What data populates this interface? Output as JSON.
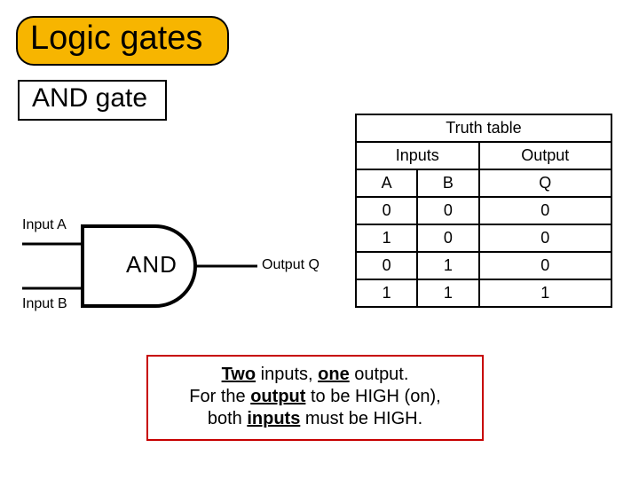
{
  "title": "Logic gates",
  "subtitle": "AND gate",
  "gate": {
    "name_label": "AND",
    "input_a_label": "Input A",
    "input_b_label": "Input B",
    "output_label": "Output Q"
  },
  "truth_table": {
    "title": "Truth table",
    "inputs_header": "Inputs",
    "output_header": "Output",
    "col_a": "A",
    "col_b": "B",
    "col_q": "Q",
    "rows": [
      {
        "a": "0",
        "b": "0",
        "q": "0"
      },
      {
        "a": "1",
        "b": "0",
        "q": "0"
      },
      {
        "a": "0",
        "b": "1",
        "q": "0"
      },
      {
        "a": "1",
        "b": "1",
        "q": "1"
      }
    ]
  },
  "summary": {
    "w_two": "Two",
    "w_inputs1": " inputs, ",
    "w_one": "one",
    "w_output1": " output.",
    "line2a": "For the ",
    "w_output2": "output",
    "line2b": " to be HIGH (on),",
    "line3a": "both ",
    "w_inputs2": "inputs",
    "line3b": " must be HIGH."
  }
}
